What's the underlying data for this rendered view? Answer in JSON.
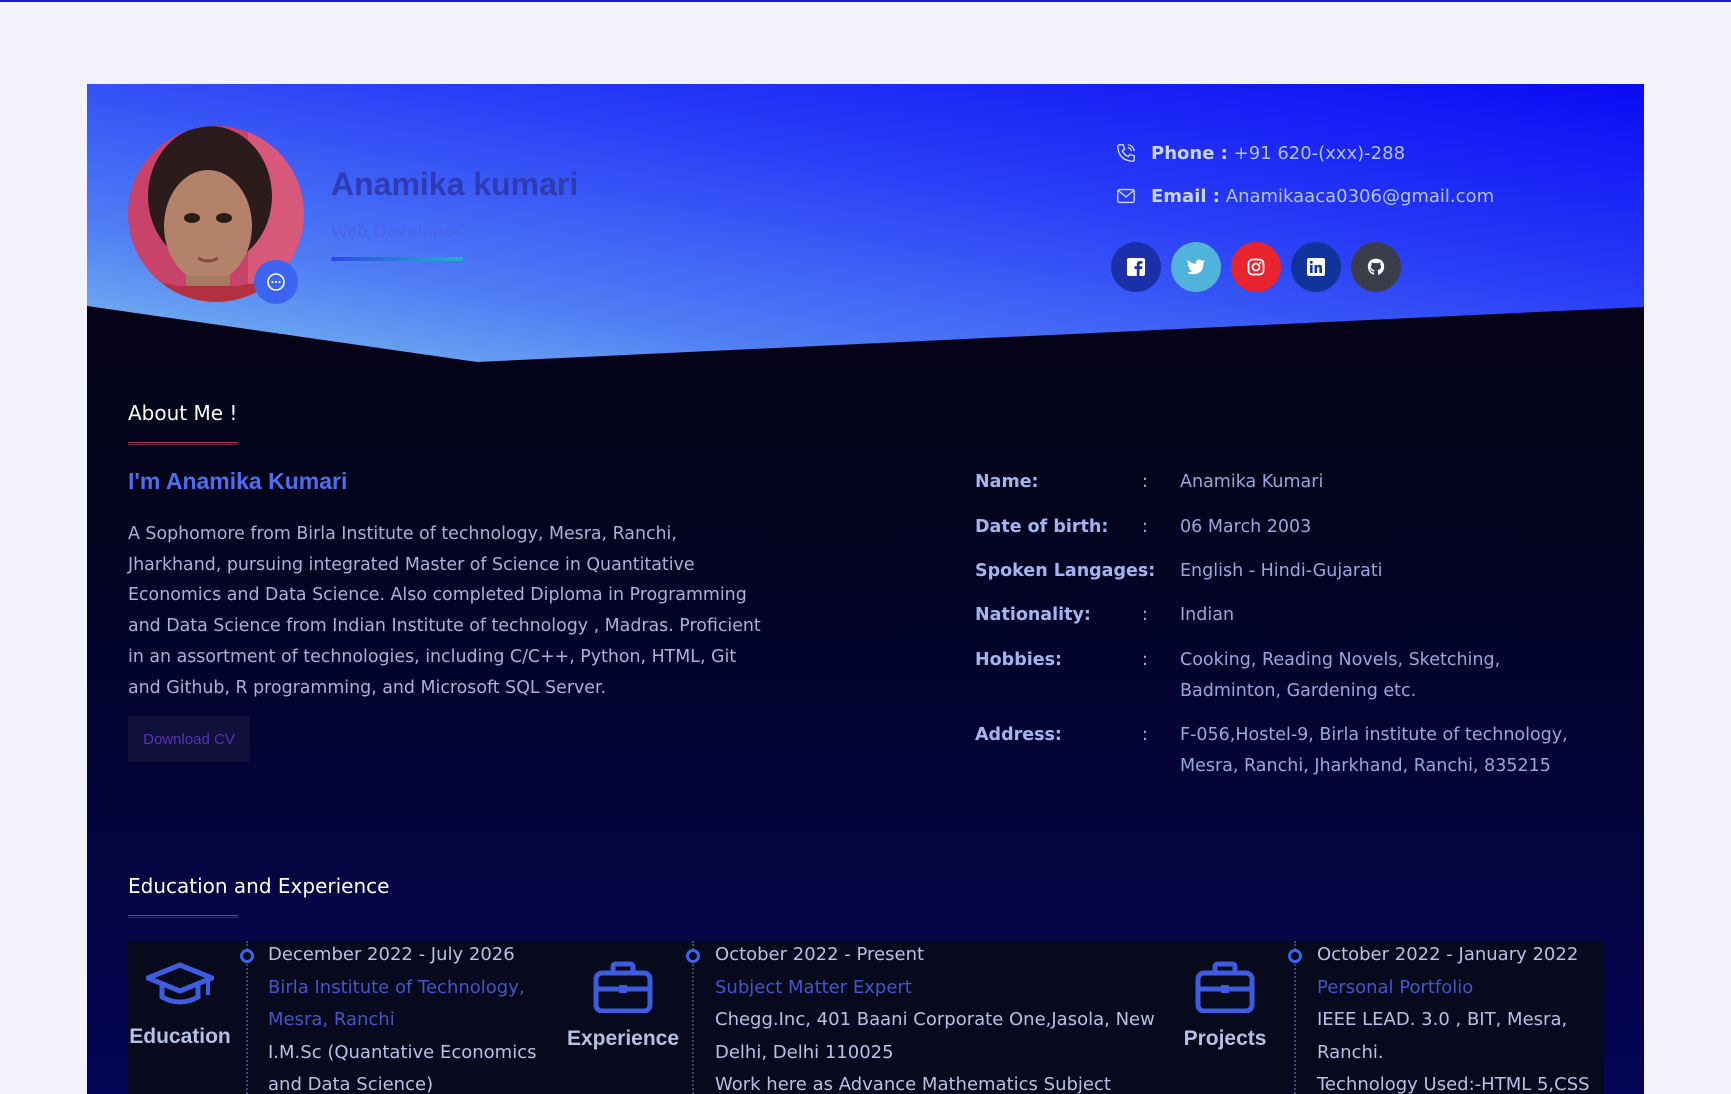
{
  "profile": {
    "name": "Anamika kumari",
    "role": "Web Developer",
    "avatar_icon": "profile-photo",
    "chat_icon": "chat-bubble-icon"
  },
  "contact": {
    "phone_label": "Phone :",
    "phone_value": "+91 620-(xxx)-288",
    "email_label": "Email :",
    "email_value": "Anamikaaca0306@gmail.com"
  },
  "socials": [
    {
      "name": "facebook",
      "color": "#1a2fa8"
    },
    {
      "name": "twitter",
      "color": "#4fb3dc"
    },
    {
      "name": "instagram",
      "color": "#e8242e"
    },
    {
      "name": "linkedin",
      "color": "#10349c"
    },
    {
      "name": "github",
      "color": "#3b3d4b"
    }
  ],
  "about": {
    "section_title": "About Me !",
    "heading": "I'm Anamika Kumari",
    "paragraph": "A Sophomore from Birla Institute of technology, Mesra, Ranchi, Jharkhand, pursuing integrated Master of Science in Quantitative Economics and Data Science. Also completed Diploma in Programming and Data Science from Indian Institute of technology , Madras. Proficient in an assortment of technologies, including C/C++, Python, HTML, Git and Github, R programming, and Microsoft SQL Server.",
    "download_label": "Download CV"
  },
  "info": {
    "separator": ":",
    "rows": [
      {
        "key": "Name:",
        "value": "Anamika Kumari"
      },
      {
        "key": "Date of birth:",
        "value": "06 March 2003"
      },
      {
        "key": "Spoken Langages:",
        "value": "English - Hindi-Gujarati"
      },
      {
        "key": "Nationality:",
        "value": "Indian"
      },
      {
        "key": "Hobbies:",
        "value": "Cooking, Reading Novels, Sketching, Badminton, Gardening etc."
      },
      {
        "key": "Address:",
        "value": "F-056,Hostel-9, Birla institute of technology, Mesra, Ranchi, Jharkhand, Ranchi, 835215"
      }
    ]
  },
  "timeline": {
    "section_title": "Education and Experience",
    "categories": [
      {
        "label": "Education",
        "icon": "graduation-cap-icon"
      },
      {
        "label": "Experience",
        "icon": "briefcase-icon"
      },
      {
        "label": "Projects",
        "icon": "briefcase-icon"
      }
    ],
    "entries": [
      {
        "date": "December 2022 - July 2026",
        "title": "Birla Institute of Technology, Mesra, Ranchi",
        "detail": "I.M.Sc (Quantative Economics and Data Science)"
      },
      {
        "date": "October 2022 - Present",
        "title": "Subject Matter Expert",
        "detail": "Chegg.Inc, 401 Baani Corporate One,Jasola, New Delhi, Delhi 110025",
        "extra": "Work here as Advance Mathematics Subject Matter"
      },
      {
        "date": "October 2022 - January 2022",
        "title": "Personal Portfolio",
        "detail": "IEEE LEAD. 3.0 , BIT, Mesra, Ranchi.",
        "extra": "Technology Used:-HTML 5,CSS"
      }
    ]
  }
}
